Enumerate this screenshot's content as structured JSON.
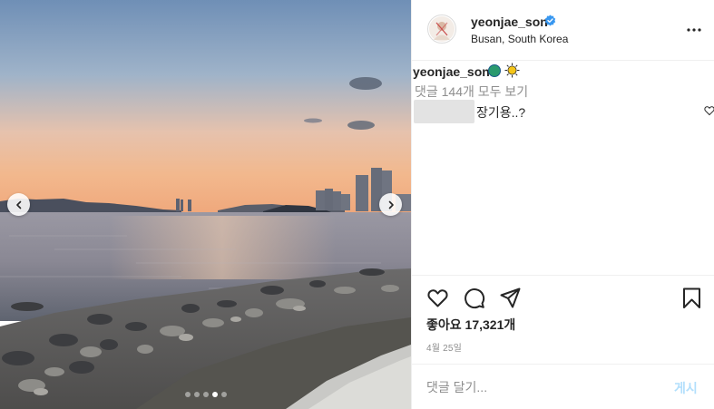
{
  "post": {
    "photo_alt": "",
    "carousel": {
      "count": 5,
      "active_index": 3
    }
  },
  "header": {
    "username": "yeonjae_son",
    "location": "Busan, South Korea",
    "verified_icon": "verified-badge-icon",
    "more_icon": "more-options-icon"
  },
  "caption": {
    "username": "yeonjae_son",
    "emojis": [
      "globe-emoji",
      "sun-emoji"
    ]
  },
  "comments": {
    "view_all_label": "댓글 144개 모두 보기",
    "items": [
      {
        "text": "장기용..?"
      }
    ]
  },
  "actions": {
    "icons": [
      "heart-icon",
      "comment-icon",
      "share-icon",
      "bookmark-icon"
    ]
  },
  "likes": {
    "label": "좋아요 17,321개"
  },
  "date": {
    "label": "4월 25일"
  },
  "comment_bar": {
    "placeholder": "댓글 달기...",
    "post_label": "게시"
  },
  "colors": {
    "text": "#262626",
    "secondary": "#8e8e8e",
    "border": "#efefef",
    "post_disabled": "#b2dffc",
    "verified": "#3897f0"
  }
}
